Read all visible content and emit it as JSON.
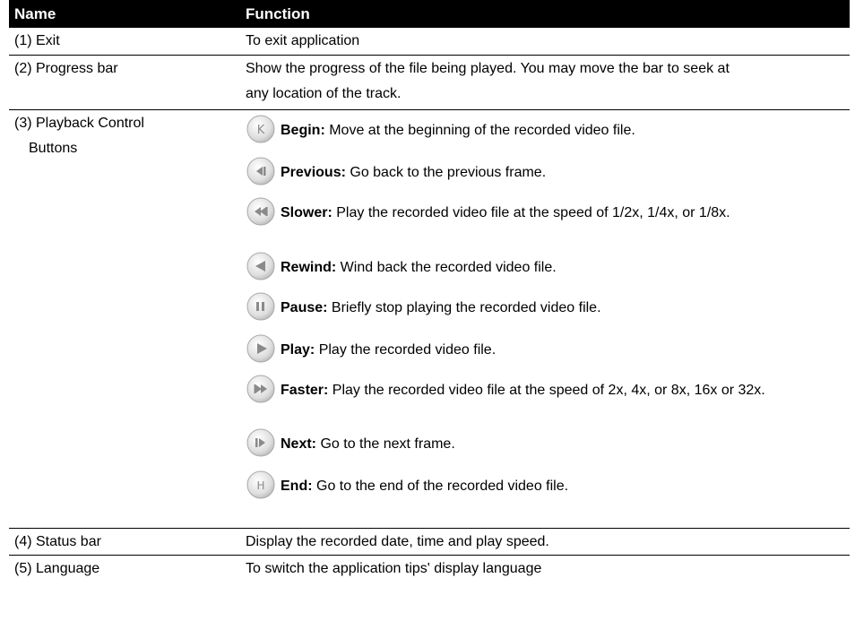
{
  "header": {
    "name": "Name",
    "function": "Function"
  },
  "rows": [
    {
      "name": "(1) Exit",
      "function": "To exit application"
    },
    {
      "name": "(2) Progress bar",
      "function": "Show the progress of the file being played. You may move the bar to seek at any location of the track."
    },
    {
      "name_line1": "(3) Playback Control",
      "name_line2": "Buttons"
    },
    {
      "name": "(4) Status bar",
      "function": "Display the recorded date, time and play speed."
    },
    {
      "name": "(5) Language",
      "function": "To switch the application tips' display language"
    }
  ],
  "buttons": [
    {
      "icon": "begin-icon",
      "label": "Begin:",
      "desc": " Move at the beginning of the recorded video file."
    },
    {
      "icon": "previous-icon",
      "label": "Previous:",
      "desc": " Go back to the previous frame."
    },
    {
      "icon": "slower-icon",
      "label": "Slower:",
      "desc": " Play the recorded video file at the speed of 1/2x, 1/4x, or 1/8x."
    },
    {
      "icon": "rewind-icon",
      "label": "Rewind:",
      "desc": " Wind back the recorded video file."
    },
    {
      "icon": "pause-icon",
      "label": "Pause:",
      "desc": " Briefly stop playing the recorded video file."
    },
    {
      "icon": "play-icon",
      "label": "Play:",
      "desc": " Play the recorded video file."
    },
    {
      "icon": "faster-icon",
      "label": "Faster:",
      "desc": " Play the recorded video file at the speed of 2x, 4x, or 8x, 16x or 32x."
    },
    {
      "icon": "next-icon",
      "label": "Next:",
      "desc": " Go to the next frame."
    },
    {
      "icon": "end-icon",
      "label": "End:",
      "desc": " Go to the end of the recorded video file."
    }
  ]
}
